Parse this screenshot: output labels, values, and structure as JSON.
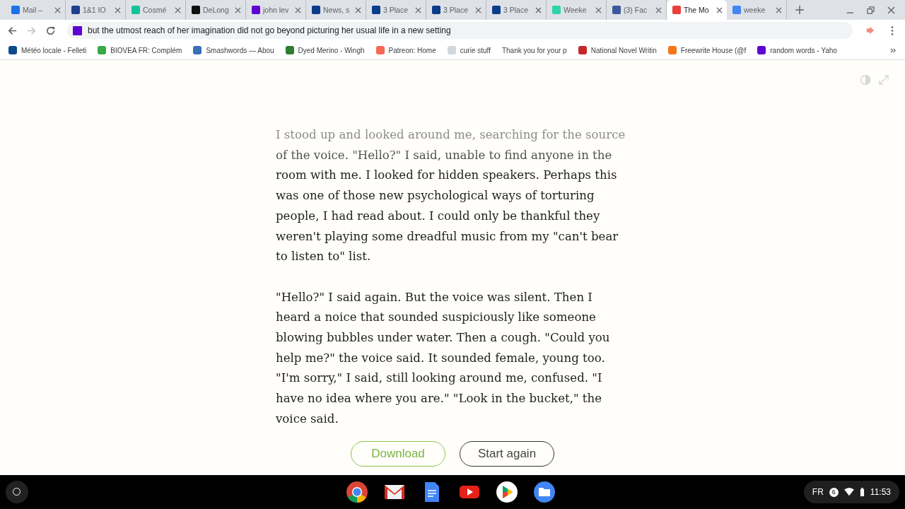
{
  "tabs": [
    {
      "title": "Mail – ",
      "selected": false
    },
    {
      "title": "1&1 IO",
      "selected": false
    },
    {
      "title": "Cosmé",
      "selected": false
    },
    {
      "title": "DeLong",
      "selected": false
    },
    {
      "title": "john lev",
      "selected": false
    },
    {
      "title": "News, s",
      "selected": false
    },
    {
      "title": "3 Place",
      "selected": false
    },
    {
      "title": "3 Place",
      "selected": false
    },
    {
      "title": "3 Place",
      "selected": false
    },
    {
      "title": "Weeke",
      "selected": false
    },
    {
      "title": "(3) Fac",
      "selected": false
    },
    {
      "title": "The Mo",
      "selected": true
    },
    {
      "title": "weeke",
      "selected": false
    }
  ],
  "address_bar": {
    "value": "but the utmost reach of her imagination did not go beyond picturing her usual life in a new setting"
  },
  "bookmarks": [
    "Météo locale - Felleti",
    "BIOVEA FR: Complém",
    "Smashwords — Abou",
    "Dyed Merino - Wingh",
    "Patreon: Home",
    "curie stuff",
    "Thank you for your p",
    "National Novel Writin",
    "Freewrite House (@f",
    "random words - Yaho"
  ],
  "story": {
    "paragraphs": [
      "I stood up and looked around me, searching for the source of the voice. \"Hello?\" I said, unable to find anyone in the room with me. I looked for hidden speakers. Perhaps this was one of those new psychological ways of torturing people, I had read about. I could only be thankful they weren't playing some dreadful music from my \"can't bear to listen to\" list.",
      "\"Hello?\" I said again. But the voice was silent. Then I heard a noice that sounded suspiciously like someone blowing bubbles under water. Then a cough. \"Could you help me?\" the voice said. It sounded female, young too. \"I'm sorry,\" I said, still looking around me, confused. \"I have no idea where you are.\" \"Look in the bucket,\" the voice said."
    ],
    "buttons": [
      {
        "label": "Download",
        "kind": "primary"
      },
      {
        "label": "Start again",
        "kind": "secondary"
      }
    ]
  },
  "shelf": {
    "language": "FR",
    "notification_count": "6",
    "time": "11:53"
  }
}
